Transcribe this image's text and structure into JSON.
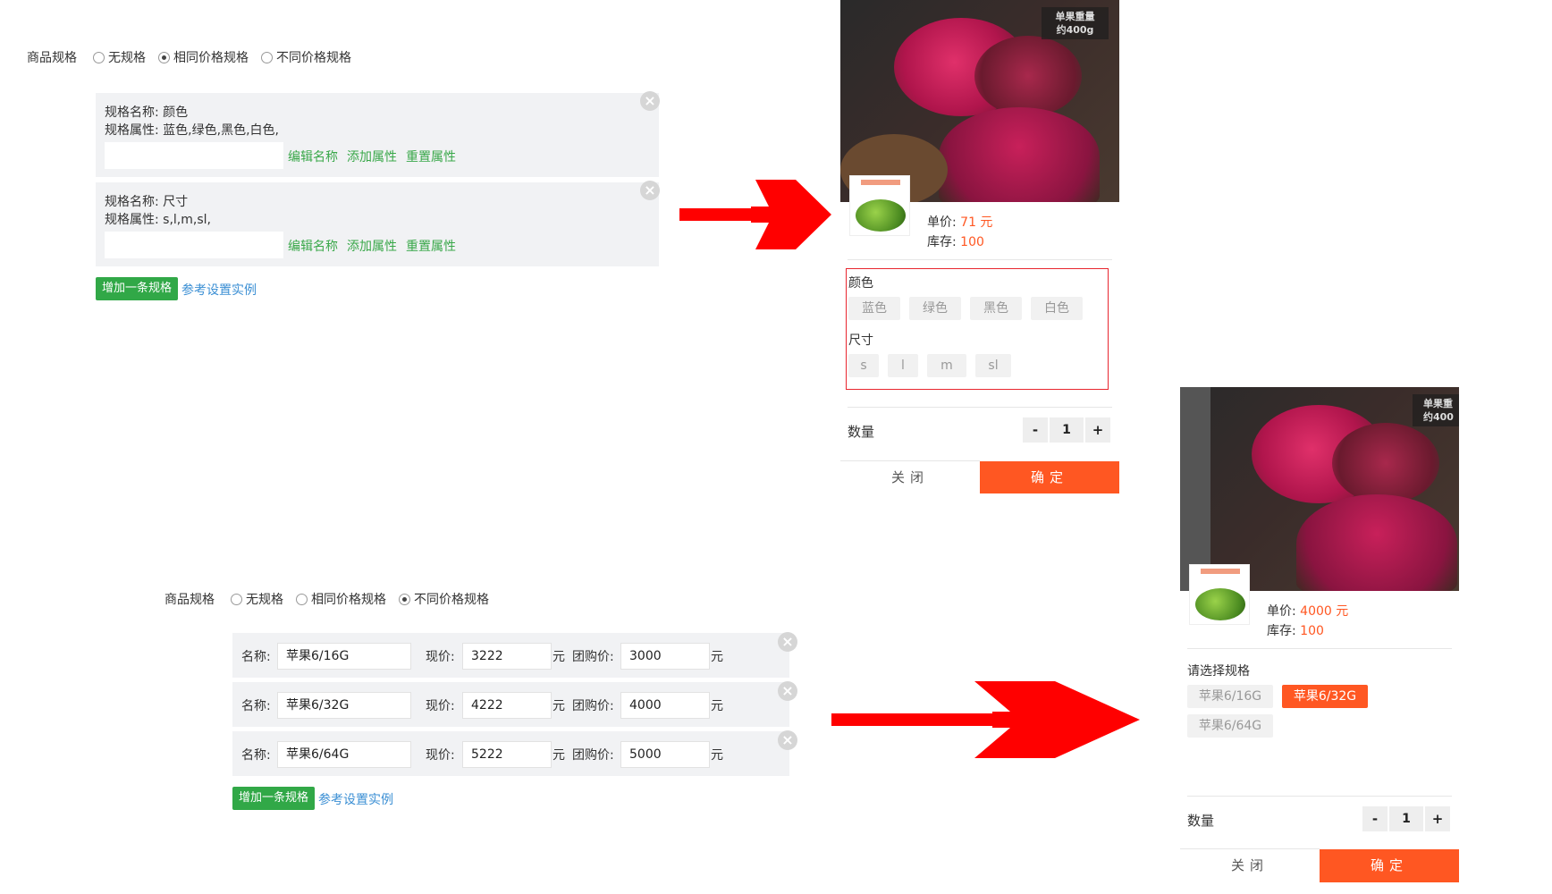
{
  "spec_label": "商品规格",
  "spec_options": [
    "无规格",
    "相同价格规格",
    "不同价格规格"
  ],
  "panel1": {
    "specs": [
      {
        "name_line": "规格名称: 颜色",
        "attr_line": "规格属性: 蓝色,绿色,黑色,白色,"
      },
      {
        "name_line": "规格名称: 尺寸",
        "attr_line": "规格属性: s,l,m,sl,"
      }
    ],
    "actions": [
      "编辑名称",
      "添加属性",
      "重置属性"
    ],
    "add_button": "增加一条规格",
    "reference_link": "参考设置实例"
  },
  "panel2": {
    "row_labels": {
      "name": "名称:",
      "price": "现价:",
      "unit": "元",
      "group": "团购价:"
    },
    "rows": [
      {
        "name": "苹果6/16G",
        "price": "3222",
        "group": "3000"
      },
      {
        "name": "苹果6/32G",
        "price": "4222",
        "group": "4000"
      },
      {
        "name": "苹果6/64G",
        "price": "5222",
        "group": "5000"
      }
    ],
    "add_button": "增加一条规格",
    "reference_link": "参考设置实例"
  },
  "preview1": {
    "image_badge": "单果重量\n约400g",
    "price_label": "单价:",
    "price_value": "71 元",
    "stock_label": "库存:",
    "stock_value": "100",
    "group1_title": "颜色",
    "group1_chips": [
      "蓝色",
      "绿色",
      "黑色",
      "白色"
    ],
    "group2_title": "尺寸",
    "group2_chips": [
      "s",
      "l",
      "m",
      "sl"
    ],
    "qty_label": "数量",
    "qty_minus": "-",
    "qty_value": "1",
    "qty_plus": "+",
    "close_label": "关闭",
    "confirm_label": "确定"
  },
  "preview2": {
    "image_badge": "单果重\n约400",
    "price_label": "单价:",
    "price_value": "4000 元",
    "stock_label": "库存:",
    "stock_value": "100",
    "select_title": "请选择规格",
    "chips": [
      "苹果6/16G",
      "苹果6/32G",
      "苹果6/64G"
    ],
    "selected_chip": "苹果6/32G",
    "qty_label": "数量",
    "qty_minus": "-",
    "qty_value": "1",
    "qty_plus": "+",
    "close_label": "关闭",
    "confirm_label": "确定"
  },
  "colors": {
    "accent_orange": "#ff5722",
    "green": "#31a847",
    "arrow_red": "#ff0000",
    "link_blue": "#3b8fd4"
  }
}
